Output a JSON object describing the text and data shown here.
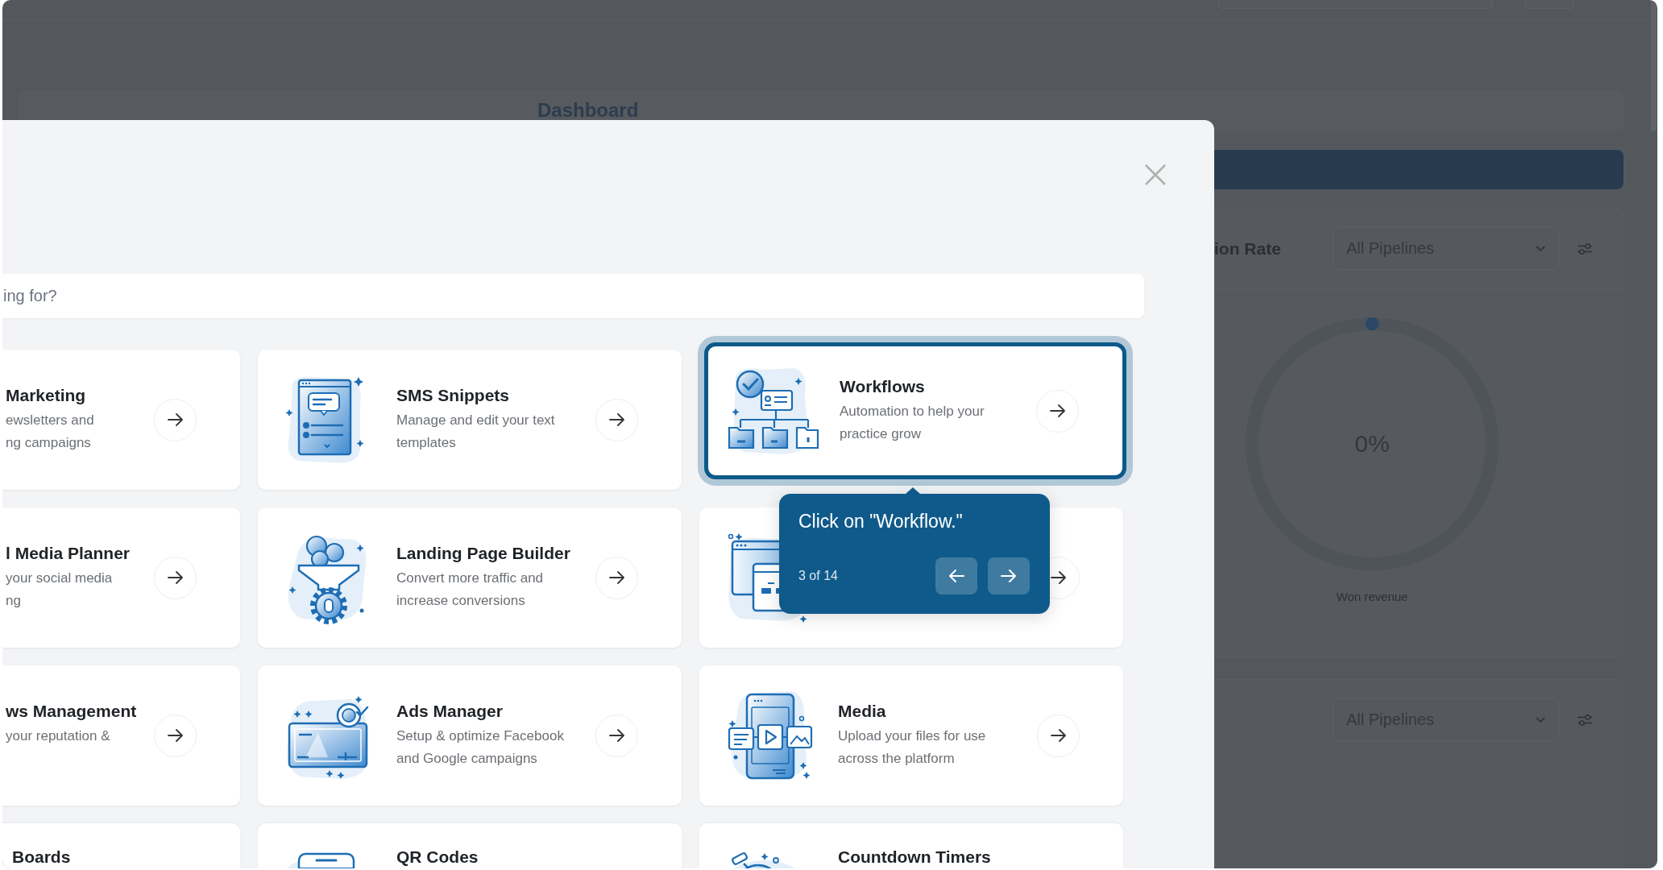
{
  "dashboard": {
    "tab": "Dashboard",
    "panels": [
      {
        "title": "ion Rate",
        "dropdown": "All Pipelines",
        "gauge": {
          "value": "0%",
          "caption": "Won revenue"
        }
      },
      {
        "dropdown": "All Pipelines"
      }
    ]
  },
  "modal": {
    "search": {
      "placeholder": "ing for?"
    },
    "cards": [
      {
        "kind": "clipped",
        "title": "Marketing",
        "description": [
          "ewsletters and",
          "ng campaigns"
        ],
        "highlighted": false
      },
      {
        "kind": "full",
        "title": "SMS Snippets",
        "description": [
          "Manage and edit your text",
          "templates"
        ],
        "highlighted": false
      },
      {
        "kind": "full",
        "title": "Workflows",
        "description": [
          "Automation to help your",
          "practice grow"
        ],
        "highlighted": true
      },
      {
        "kind": "clipped",
        "title": "l Media Planner",
        "description": [
          "your social media",
          "ng"
        ],
        "highlighted": false
      },
      {
        "kind": "full",
        "title": "Landing Page Builder",
        "description": [
          "Convert more traffic and",
          "increase conversions"
        ],
        "highlighted": false
      },
      {
        "kind": "full",
        "highlighted": false
      },
      {
        "kind": "clipped",
        "title": "ws Management",
        "description": [
          "your reputation &"
        ],
        "highlighted": false
      },
      {
        "kind": "full",
        "title": "Ads Manager",
        "description": [
          "Setup & optimize Facebook",
          "and Google campaigns"
        ],
        "highlighted": false
      },
      {
        "kind": "full",
        "title": "Media",
        "description": [
          "Upload your files for use",
          "across the platform"
        ],
        "highlighted": false
      }
    ],
    "bottom_row": [
      {
        "kind": "clipped",
        "title": "Boards"
      },
      {
        "kind": "full",
        "title": "QR Codes"
      },
      {
        "kind": "full",
        "title": "Countdown Timers"
      }
    ]
  },
  "tour_tooltip": {
    "text": "Click on \"Workflow.\"",
    "progress": "3 of 14"
  }
}
